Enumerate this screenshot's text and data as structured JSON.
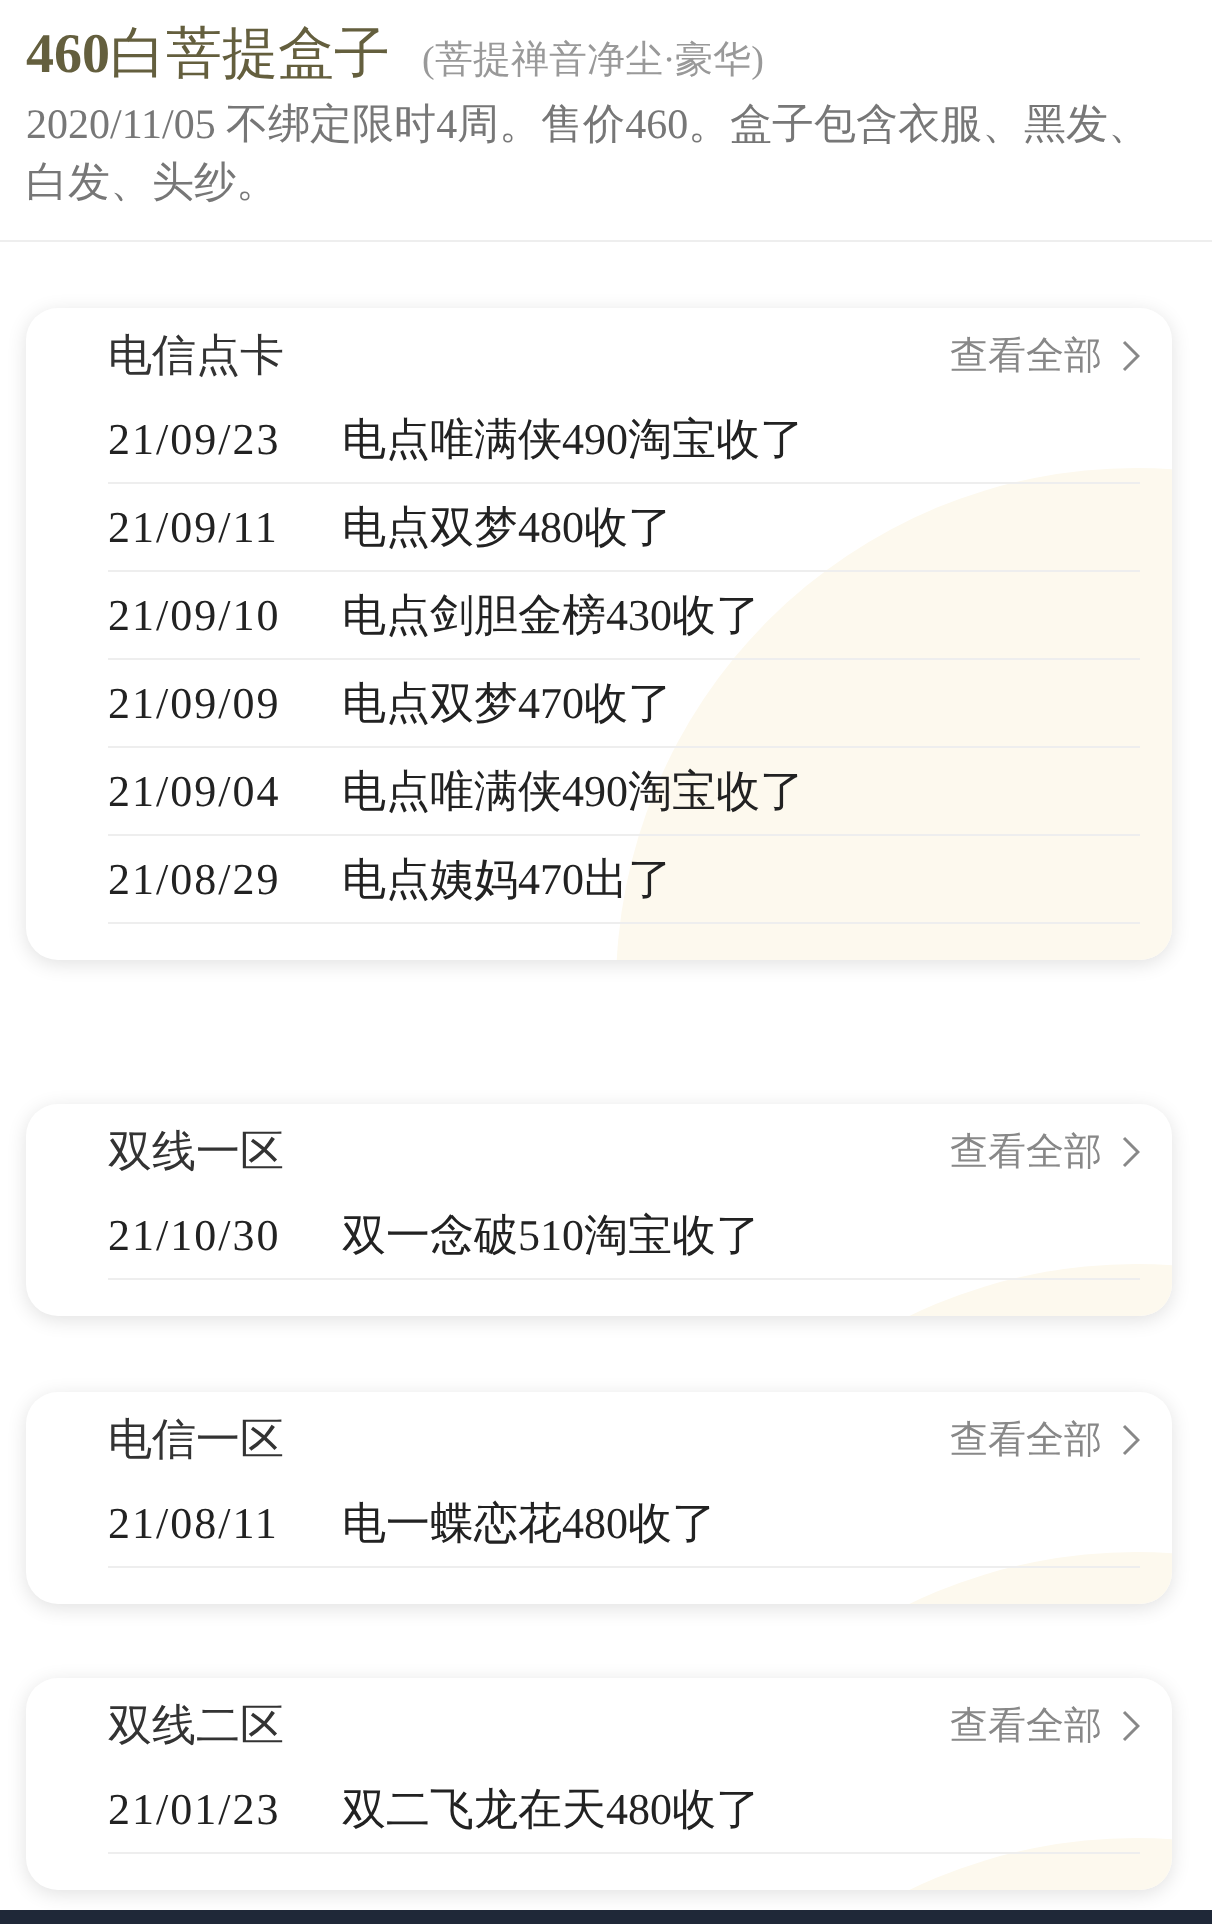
{
  "header": {
    "title_number": "460",
    "title": "白菩提盒子",
    "subtitle": "(菩提禅音净尘·豪华)",
    "description": "2020/11/05 不绑定限时4周。售价460。盒子包含衣服、黑发、白发、头纱。"
  },
  "sections": [
    {
      "name": "电信点卡",
      "view_all": "查看全部",
      "entries": [
        {
          "date": "21/09/23",
          "text": "电点唯满侠490淘宝收了"
        },
        {
          "date": "21/09/11",
          "text": "电点双梦480收了"
        },
        {
          "date": "21/09/10",
          "text": "电点剑胆金榜430收了"
        },
        {
          "date": "21/09/09",
          "text": "电点双梦470收了"
        },
        {
          "date": "21/09/04",
          "text": "电点唯满侠490淘宝收了"
        },
        {
          "date": "21/08/29",
          "text": "电点姨妈470出了"
        }
      ]
    },
    {
      "name": "双线一区",
      "view_all": "查看全部",
      "entries": [
        {
          "date": "21/10/30",
          "text": "双一念破510淘宝收了"
        }
      ]
    },
    {
      "name": "电信一区",
      "view_all": "查看全部",
      "entries": [
        {
          "date": "21/08/11",
          "text": "电一蝶恋花480收了"
        }
      ]
    },
    {
      "name": "双线二区",
      "view_all": "查看全部",
      "entries": [
        {
          "date": "21/01/23",
          "text": "双二飞龙在天480收了"
        }
      ]
    }
  ]
}
